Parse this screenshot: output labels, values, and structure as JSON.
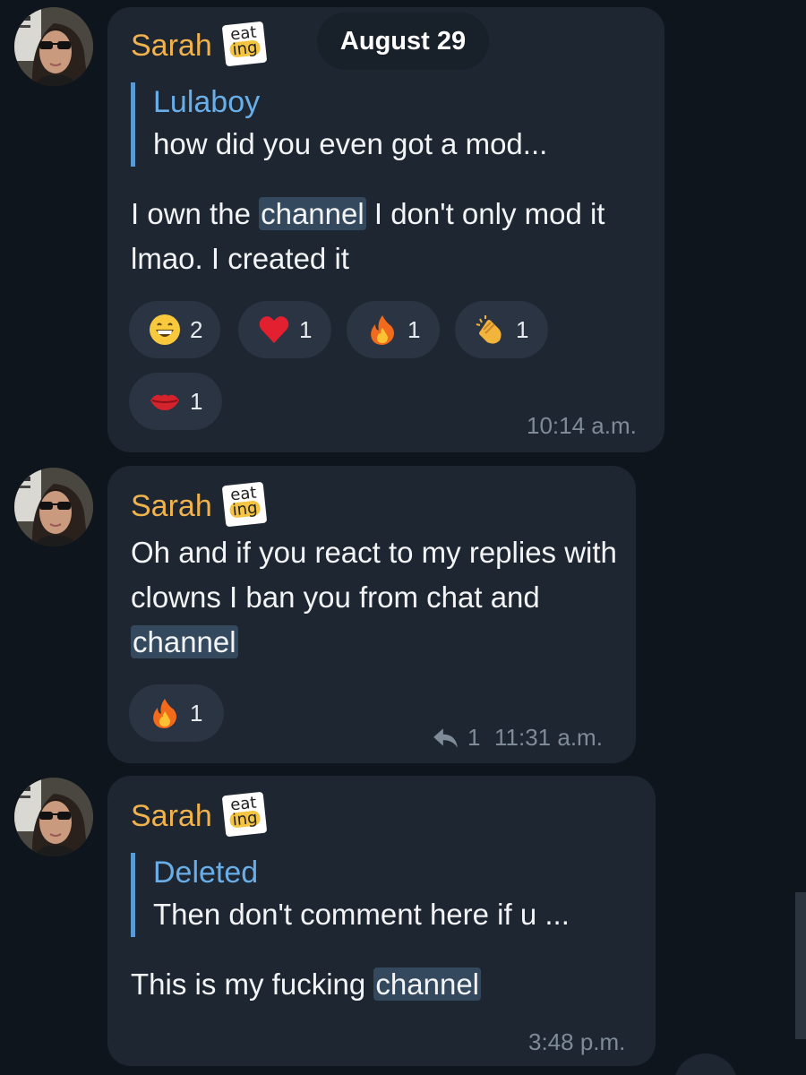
{
  "date_separator": "August 29",
  "messages": [
    {
      "sender": "Sarah",
      "badge_top": "eat",
      "badge_bottom": "ing",
      "reply": {
        "name": "Lulaboy",
        "text": "how did you even got a mod..."
      },
      "text_before": "I own the ",
      "highlight": "channel",
      "text_after": " I don't only mod it lmao. I created it",
      "reactions": [
        {
          "icon": "grinning-face-icon",
          "count": "2"
        },
        {
          "icon": "red-heart-icon",
          "count": "1"
        },
        {
          "icon": "fire-icon",
          "count": "1"
        },
        {
          "icon": "clapping-hands-icon",
          "count": "1"
        },
        {
          "icon": "kiss-mark-icon",
          "count": "1"
        }
      ],
      "time": "10:14 a.m."
    },
    {
      "sender": "Sarah",
      "badge_top": "eat",
      "badge_bottom": "ing",
      "text_before": "Oh and if you react to my replies with clowns I ban you from chat and ",
      "highlight": "channel",
      "reactions": [
        {
          "icon": "fire-icon",
          "count": "1"
        }
      ],
      "reply_count": "1",
      "time": "11:31 a.m."
    },
    {
      "sender": "Sarah",
      "badge_top": "eat",
      "badge_bottom": "ing",
      "reply": {
        "name": "Deleted",
        "text": "Then don't comment here if u ..."
      },
      "text_before": "This is my fucking ",
      "highlight": "channel",
      "time": "3:48 p.m."
    }
  ],
  "colors": {
    "background": "#0e151d",
    "bubble": "#1e2632",
    "sender_name": "#f0b24c",
    "reply_accent": "#5b9bd5",
    "link_highlight": "#34495d",
    "reaction_chip": "#2a3442",
    "timestamp": "#7f8b98"
  }
}
